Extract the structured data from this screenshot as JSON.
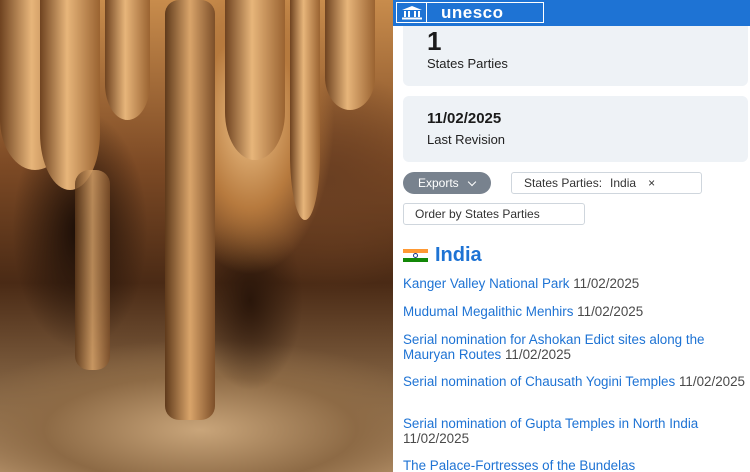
{
  "header": {
    "logo_text": "unesco",
    "logo_icon": "temple-icon",
    "brand_color": "#1e73d4"
  },
  "stats": [
    {
      "value": "1",
      "label": "States Parties"
    },
    {
      "value": "11/02/2025",
      "label": "Last Revision"
    }
  ],
  "toolbar": {
    "exports_label": "Exports",
    "filter_label": "States Parties:",
    "filter_value": "India",
    "filter_close": "×",
    "order_label": "Order by States Parties"
  },
  "country": {
    "name": "India",
    "flag_colors": [
      "#ff9933",
      "#ffffff",
      "#138808"
    ]
  },
  "sites": [
    {
      "title": "Kanger Valley National Park",
      "date": "11/02/2025"
    },
    {
      "title": "Mudumal Megalithic Menhirs",
      "date": "11/02/2025"
    },
    {
      "title": "Serial nomination for Ashokan Edict sites along the Mauryan Routes",
      "date": "11/02/2025"
    },
    {
      "title": "Serial nomination of Chausath Yogini Temples",
      "date": "11/02/2025"
    },
    {
      "title": "Serial nomination of Gupta Temples in North India",
      "date": "11/02/2025"
    },
    {
      "title": "The Palace-Fortresses of the Bundelas",
      "date": ""
    }
  ]
}
